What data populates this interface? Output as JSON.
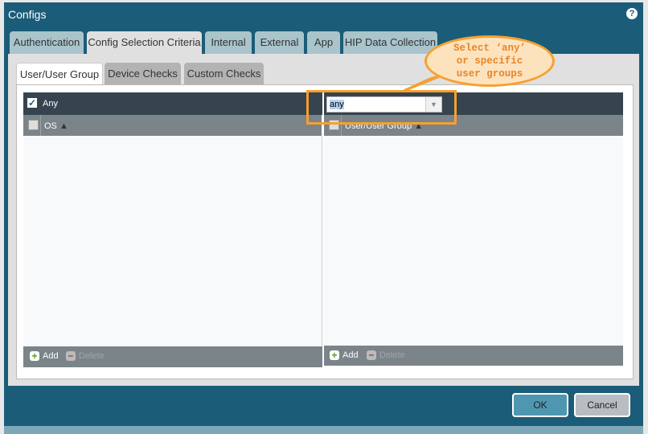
{
  "window": {
    "title": "Configs",
    "help_icon": "help-circle-icon"
  },
  "tabs": [
    {
      "label": "Authentication"
    },
    {
      "label": "Config Selection Criteria",
      "active": true
    },
    {
      "label": "Internal"
    },
    {
      "label": "External"
    },
    {
      "label": "App"
    },
    {
      "label": "HIP Data Collection"
    }
  ],
  "subtabs": [
    {
      "label": "User/User Group",
      "active": true
    },
    {
      "label": "Device Checks"
    },
    {
      "label": "Custom Checks"
    }
  ],
  "left_grid": {
    "any_label": "Any",
    "any_checked": true,
    "column": "OS",
    "add": "Add",
    "delete": "Delete"
  },
  "right_grid": {
    "select_value": "any",
    "column": "User/User Group",
    "add": "Add",
    "delete": "Delete"
  },
  "callout": {
    "line1": "Select ‘any’",
    "line2": "or specific",
    "line3": "user groups",
    "color": "#f7a030"
  },
  "buttons": {
    "ok": "OK",
    "cancel": "Cancel"
  }
}
